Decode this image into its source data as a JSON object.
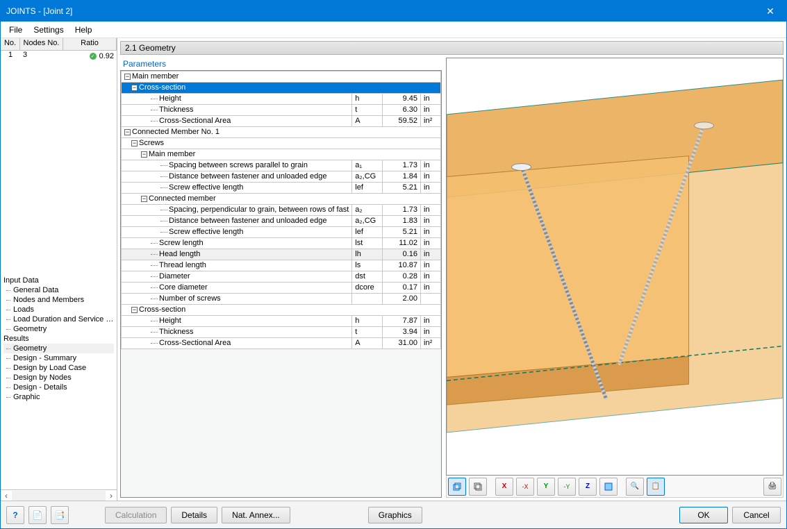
{
  "window": {
    "title": "JOINTS - [Joint 2]"
  },
  "menu": {
    "file": "File",
    "settings": "Settings",
    "help": "Help"
  },
  "nav_header": {
    "no": "No.",
    "nodes": "Nodes No.",
    "ratio": "Ratio"
  },
  "nav_row": {
    "no": "1",
    "nodes": "3",
    "ratio": "0.92"
  },
  "tree": {
    "input_data": "Input Data",
    "general_data": "General Data",
    "nodes_members": "Nodes and Members",
    "loads": "Loads",
    "load_duration": "Load Duration and Service Clas",
    "geometry": "Geometry",
    "results": "Results",
    "r_geometry": "Geometry",
    "r_summary": "Design - Summary",
    "r_loadcase": "Design by Load Case",
    "r_nodes": "Design by Nodes",
    "r_details": "Design - Details",
    "r_graphic": "Graphic"
  },
  "section": {
    "title": "2.1 Geometry"
  },
  "param_header": "Parameters",
  "groups": {
    "main_member": "Main member",
    "cross_section": "Cross-section",
    "connected_member": "Connected Member No. 1",
    "screws": "Screws",
    "mm_main": "Main member",
    "mm_connected": "Connected member",
    "cs2": "Cross-section"
  },
  "rows": {
    "height": {
      "label": "Height",
      "sym": "h",
      "val": "9.45",
      "unit": "in"
    },
    "thickness": {
      "label": "Thickness",
      "sym": "t",
      "val": "6.30",
      "unit": "in"
    },
    "csa": {
      "label": "Cross-Sectional Area",
      "sym": "A",
      "val": "59.52",
      "unit": "in²"
    },
    "spg": {
      "label": "Spacing between screws parallel to grain",
      "sym": "a₁",
      "val": "1.73",
      "unit": "in"
    },
    "dfu": {
      "label": "Distance between fastener and unloaded edge",
      "sym": "a₂,CG",
      "val": "1.84",
      "unit": "in"
    },
    "sel": {
      "label": "Screw effective length",
      "sym": "lef",
      "val": "5.21",
      "unit": "in"
    },
    "spr": {
      "label": "Spacing, perpendicular to grain, between rows of fast",
      "sym": "a₂",
      "val": "1.73",
      "unit": "in"
    },
    "dfu2": {
      "label": "Distance between fastener and unloaded edge",
      "sym": "a₂,CG",
      "val": "1.83",
      "unit": "in"
    },
    "sel2": {
      "label": "Screw effective length",
      "sym": "lef",
      "val": "5.21",
      "unit": "in"
    },
    "slen": {
      "label": "Screw length",
      "sym": "lst",
      "val": "11.02",
      "unit": "in"
    },
    "hlen": {
      "label": "Head length",
      "sym": "lh",
      "val": "0.16",
      "unit": "in"
    },
    "tlen": {
      "label": "Thread length",
      "sym": "ls",
      "val": "10.87",
      "unit": "in"
    },
    "dia": {
      "label": "Diameter",
      "sym": "dst",
      "val": "0.28",
      "unit": "in"
    },
    "cdia": {
      "label": "Core diameter",
      "sym": "dcore",
      "val": "0.17",
      "unit": "in"
    },
    "nscr": {
      "label": "Number of screws",
      "sym": "",
      "val": "2.00",
      "unit": ""
    },
    "height2": {
      "label": "Height",
      "sym": "h",
      "val": "7.87",
      "unit": "in"
    },
    "thick2": {
      "label": "Thickness",
      "sym": "t",
      "val": "3.94",
      "unit": "in"
    },
    "csa2": {
      "label": "Cross-Sectional Area",
      "sym": "A",
      "val": "31.00",
      "unit": "in²"
    }
  },
  "toolbar3d": {
    "iso1": "⬚",
    "iso2": "⬚",
    "x": "X",
    "xn": "-X",
    "y": "Y",
    "yn": "-Y",
    "z": "Z",
    "cube": "▣",
    "mag": "🔍",
    "copy": "📋",
    "print": "🖨"
  },
  "buttons": {
    "help": "?",
    "calc": "Calculation",
    "details": "Details",
    "annex": "Nat. Annex...",
    "graphics": "Graphics",
    "ok": "OK",
    "cancel": "Cancel"
  }
}
